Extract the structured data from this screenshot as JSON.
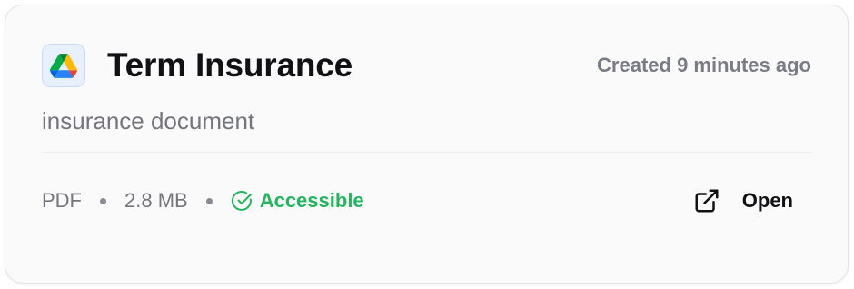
{
  "card": {
    "app_icon": "google-drive-icon",
    "title": "Term Insurance",
    "created": "Created 9 minutes ago",
    "description": "insurance document",
    "file_type": "PDF",
    "file_size": "2.8 MB",
    "status": {
      "label": "Accessible",
      "icon": "check-circle-icon",
      "color": "#22b55b"
    },
    "open_button": {
      "label": "Open",
      "icon": "external-link-icon"
    }
  }
}
